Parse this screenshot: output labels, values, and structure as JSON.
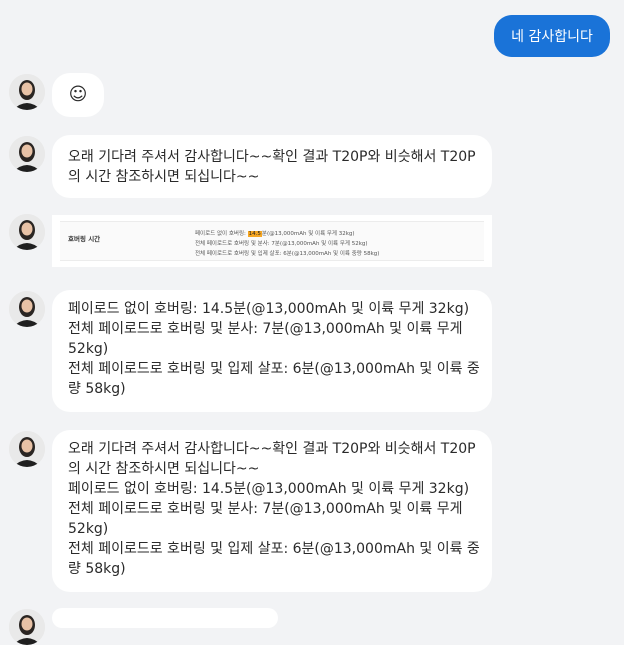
{
  "chat": {
    "user_message": "네 감사합니다",
    "emoji_reply": "☺",
    "messages": [
      {
        "lines": [
          "오래 기다려 주셔서 감사합니다~~확인 결과 T20P와 비슷해서 T20P",
          "의 시간 참조하시면 되십니다~~"
        ]
      },
      {
        "lines": [
          "페이로드 없이 호버링: 14.5분(@13,000mAh 및 이륙 무게 32kg)",
          "전체 페이로드로 호버링 및 분사: 7분(@13,000mAh 및 이륙 무게",
          "52kg)",
          "전체 페이로드로 호버링 및 입제 살포: 6분(@13,000mAh 및 이륙 중",
          "량 58kg)"
        ]
      },
      {
        "lines": [
          "오래 기다려 주셔서 감사합니다~~확인 결과 T20P와 비슷해서 T20P",
          "의 시간 참조하시면 되십니다~~",
          "페이로드 없이 호버링: 14.5분(@13,000mAh 및 이륙 무게 32kg)",
          "전체 페이로드로 호버링 및 분사: 7분(@13,000mAh 및 이륙 무게",
          "52kg)",
          "전체 페이로드로 호버링 및 입제 살포: 6분(@13,000mAh 및 이륙 중",
          "량 58kg)"
        ]
      }
    ],
    "spec_image": {
      "label": "호버링 시간",
      "line1_pre": "페이로드 없이 호버링: ",
      "line1_highlight": "14.5",
      "line1_post": "분(@13,000mAh 및 이륙 무게 32kg)",
      "line2": "전체 페이로드로 호버링 및 분사: 7분(@13,000mAh 및 이륙 무게 52kg)",
      "line3": "전체 페이로드로 호버링 및 입제 살포: 6분(@13,000mAh 및 이륙 중량 58kg)"
    }
  }
}
